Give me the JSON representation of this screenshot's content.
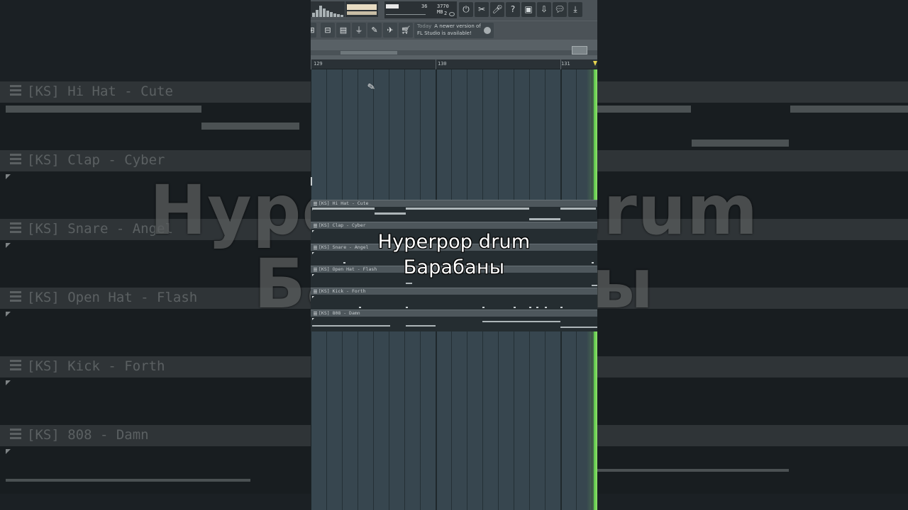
{
  "toolbar": {
    "cpu_value": "36",
    "memory_value": "3770 MB",
    "poly_count": "2"
  },
  "hint_bar": {
    "prefix": "Today",
    "line1": "A newer version of",
    "line2": "FL Studio is available!"
  },
  "timeline": {
    "bars": [
      "129",
      "130",
      "131"
    ]
  },
  "playlist": {
    "tracks": [
      {
        "name": "[KS] Hi Hat - Cute"
      },
      {
        "name": "[KS] Clap - Cyber"
      },
      {
        "name": "[KS] Snare - Angel"
      },
      {
        "name": "[KS] Open Hat - Flash"
      },
      {
        "name": "[KS] Kick - Forth"
      },
      {
        "name": "[KS] 808 - Damn"
      }
    ]
  },
  "caption": {
    "line1": "Hyperpop drum",
    "line2": "Барабаны"
  },
  "background": {
    "title_line1": "Hyperpop drum",
    "title_line2": "Барабаны"
  },
  "colors": {
    "grid": "#37464f",
    "playhead_edge": "#6fd04f",
    "accent_marker": "#e7d34f"
  }
}
